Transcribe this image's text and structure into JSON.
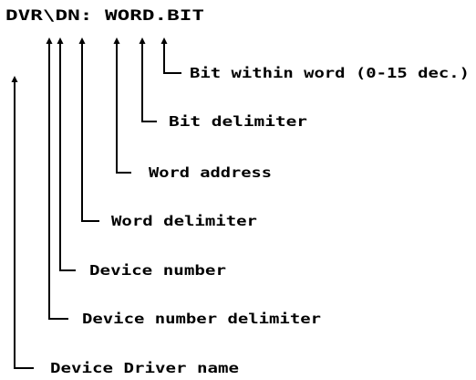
{
  "header": {
    "text": "DVR\\DN: WORD.BIT"
  },
  "labels": [
    {
      "id": "bit-within-word",
      "text": "Bit within word (0-15 dec.)"
    },
    {
      "id": "bit-delimiter",
      "text": "Bit delimiter"
    },
    {
      "id": "word-address",
      "text": "Word address"
    },
    {
      "id": "word-delimiter",
      "text": "Word delimiter"
    },
    {
      "id": "device-number",
      "text": "Device number"
    },
    {
      "id": "device-number-delimiter",
      "text": "Device number delimiter"
    },
    {
      "id": "device-driver-name",
      "text": "Device Driver name"
    }
  ],
  "colors": {
    "foreground": "#000000",
    "background": "#ffffff"
  }
}
